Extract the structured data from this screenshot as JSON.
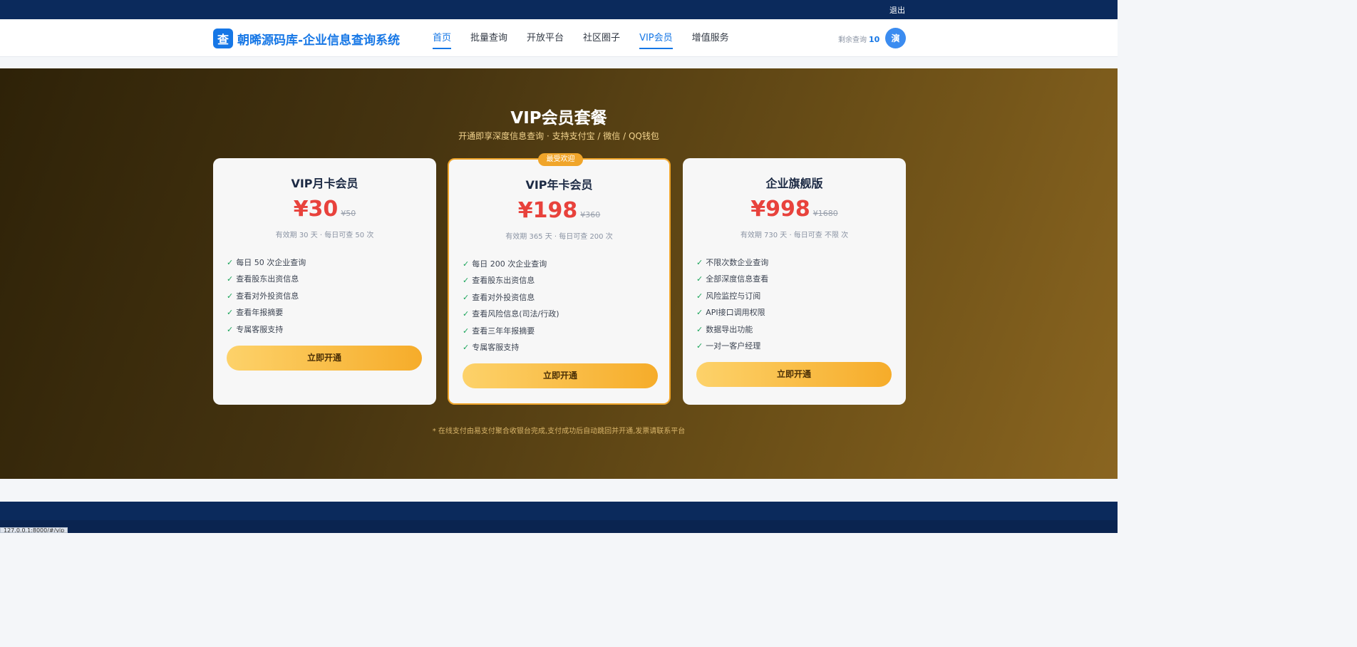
{
  "topbar": {
    "logout": "退出"
  },
  "header": {
    "logo_char": "查",
    "site_name": "朝晞源码库-企业信息查询系统",
    "nav": [
      {
        "label": "首页",
        "active": true
      },
      {
        "label": "批量查询",
        "active": false
      },
      {
        "label": "开放平台",
        "active": false
      },
      {
        "label": "社区圈子",
        "active": false
      },
      {
        "label": "VIP会员",
        "active": true
      },
      {
        "label": "增值服务",
        "active": false
      }
    ],
    "quota_label": "剩余查询",
    "quota_value": "10",
    "avatar_char": "演"
  },
  "hero": {
    "title": "VIP会员套餐",
    "subtitle": "开通即享深度信息查询 · 支持支付宝 / 微信 / QQ钱包"
  },
  "plans": [
    {
      "title": "VIP月卡会员",
      "price": "¥30",
      "old_price": "¥50",
      "validity": "有效期 30 天 · 每日可查 50 次",
      "features": [
        "每日 50 次企业查询",
        "查看股东出资信息",
        "查看对外投资信息",
        "查看年报摘要",
        "专属客服支持"
      ],
      "button": "立即开通",
      "popular": false
    },
    {
      "badge": "最受欢迎",
      "title": "VIP年卡会员",
      "price": "¥198",
      "old_price": "¥360",
      "validity": "有效期 365 天 · 每日可查 200 次",
      "features": [
        "每日 200 次企业查询",
        "查看股东出资信息",
        "查看对外投资信息",
        "查看风险信息(司法/行政)",
        "查看三年年报摘要",
        "专属客服支持"
      ],
      "button": "立即开通",
      "popular": true
    },
    {
      "title": "企业旗舰版",
      "price": "¥998",
      "old_price": "¥1680",
      "validity": "有效期 730 天 · 每日可查 不限 次",
      "features": [
        "不限次数企业查询",
        "全部深度信息查看",
        "风险监控与订阅",
        "API接口调用权限",
        "数据导出功能",
        "一对一客户经理"
      ],
      "button": "立即开通",
      "popular": false
    }
  ],
  "note": "* 在线支付由易支付聚合收银台完成,支付成功后自动跳回并开通,发票请联系平台",
  "status_url": "127.0.0.1:8000/#/vip",
  "colors": {
    "brand": "#1677e6",
    "price": "#e8423c",
    "accent": "#f0a52a",
    "check": "#1aa55a"
  }
}
